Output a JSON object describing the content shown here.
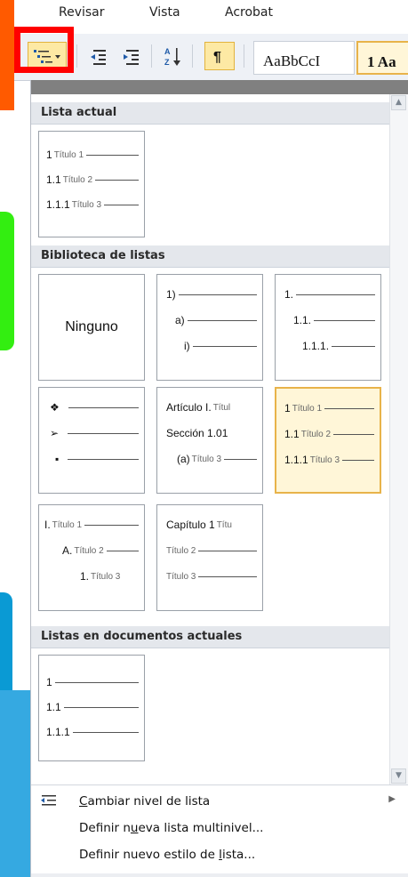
{
  "ribbon": {
    "tabs": [
      "Revisar",
      "Vista",
      "Acrobat"
    ],
    "style_previews": [
      "AaBbCcI",
      "1 Aa"
    ]
  },
  "panel": {
    "sections": {
      "current": "Lista actual",
      "library": "Biblioteca de listas",
      "documents": "Listas en documentos actuales"
    },
    "current_tile": {
      "rows": [
        {
          "num": "1",
          "text": "Título 1"
        },
        {
          "num": "1.1",
          "text": "Título 2"
        },
        {
          "num": "1.1.1",
          "text": "Título 3"
        }
      ]
    },
    "library_tiles": {
      "none_label": "Ninguno",
      "paren": [
        "1)",
        "a)",
        "i)"
      ],
      "decimal": [
        "1.",
        "1.1.",
        "1.1.1."
      ],
      "bullets": [
        "❖",
        "➢",
        "▪"
      ],
      "articles": [
        {
          "num": "Artículo I.",
          "text": "Títul"
        },
        {
          "num": "Sección 1.01",
          "text": ""
        },
        {
          "num": "(a)",
          "text": "Título 3"
        }
      ],
      "headings": [
        {
          "num": "1",
          "text": "Título 1"
        },
        {
          "num": "1.1",
          "text": "Título 2"
        },
        {
          "num": "1.1.1",
          "text": "Título 3"
        }
      ],
      "roman": [
        {
          "num": "I.",
          "text": "Título 1"
        },
        {
          "num": "A.",
          "text": "Título 2"
        },
        {
          "num": "1.",
          "text": "Título 3"
        }
      ],
      "chapter": [
        {
          "num": "Capítulo 1",
          "text": "Títu"
        },
        {
          "num": "",
          "text": "Título 2"
        },
        {
          "num": "",
          "text": "Título 3"
        }
      ]
    },
    "document_tile": [
      "1",
      "1.1",
      "1.1.1"
    ]
  },
  "menu": {
    "items": [
      {
        "pre": "",
        "acc": "C",
        "post": "ambiar nivel de lista"
      },
      {
        "pre": "Definir n",
        "acc": "u",
        "post": "eva lista multinivel..."
      },
      {
        "pre": "Definir nuevo estilo de ",
        "acc": "l",
        "post": "ista..."
      }
    ]
  },
  "colors": {
    "highlight": "#e8b34a",
    "red_frame": "#ff0000",
    "orange": "#ff5a00",
    "green": "#33ee11",
    "blue": "#0a9ad4",
    "lightblue": "#35a9e1"
  }
}
